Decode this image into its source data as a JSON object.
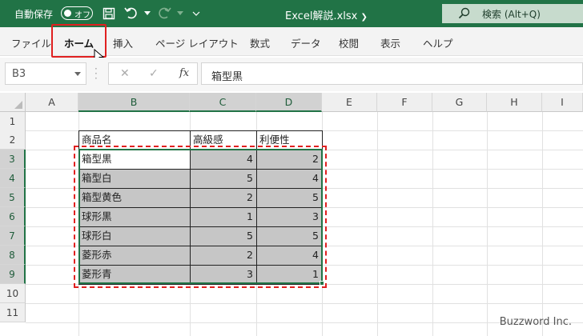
{
  "titlebar": {
    "autosave_label": "自動保存",
    "autosave_state": "オフ",
    "filename": "Excel解説.xlsx",
    "search_placeholder": "検索 (Alt+Q)"
  },
  "ribbon": {
    "tabs": [
      "ファイル",
      "ホーム",
      "挿入",
      "ページ レイアウト",
      "数式",
      "データ",
      "校閲",
      "表示",
      "ヘルプ"
    ],
    "active_tab": "ホーム"
  },
  "formula_bar": {
    "name_box": "B3",
    "formula": "箱型黒"
  },
  "grid": {
    "columns": [
      "A",
      "B",
      "C",
      "D",
      "E",
      "F",
      "G",
      "H",
      "I"
    ],
    "rows": [
      "1",
      "2",
      "3",
      "4",
      "5",
      "6",
      "7",
      "8",
      "9",
      "10",
      "11"
    ],
    "selected_columns": [
      "B",
      "C",
      "D"
    ],
    "selected_rows": [
      "3",
      "4",
      "5",
      "6",
      "7",
      "8",
      "9"
    ]
  },
  "table": {
    "headers": [
      "商品名",
      "高級感",
      "利便性"
    ],
    "rows": [
      [
        "箱型黒",
        "4",
        "2"
      ],
      [
        "箱型白",
        "5",
        "4"
      ],
      [
        "箱型黄色",
        "2",
        "5"
      ],
      [
        "球形黒",
        "1",
        "3"
      ],
      [
        "球形白",
        "5",
        "5"
      ],
      [
        "菱形赤",
        "2",
        "4"
      ],
      [
        "菱形青",
        "3",
        "1"
      ]
    ]
  },
  "colors": {
    "excel_green": "#217346",
    "highlight_red": "#e02020",
    "selection_gray": "#c6c6c6"
  },
  "watermark": "Buzzword Inc."
}
